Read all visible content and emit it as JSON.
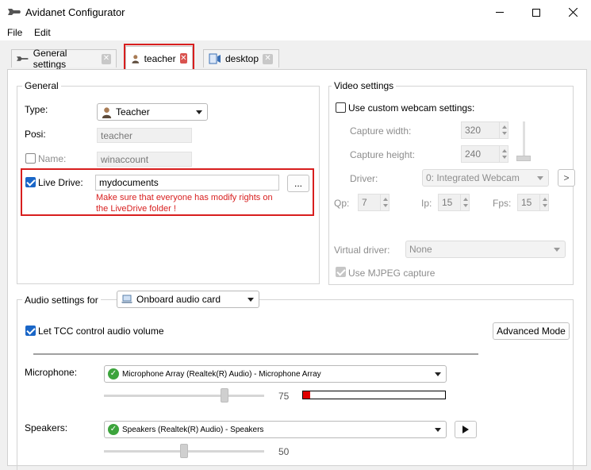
{
  "window": {
    "title": "Avidanet Configurator",
    "minimize_icon": "minimize-icon",
    "maximize_icon": "maximize-icon",
    "close_icon": "close-icon"
  },
  "menu": {
    "items": [
      "File",
      "Edit"
    ]
  },
  "tabs": [
    {
      "label": "General settings",
      "icon": "wrench-icon"
    },
    {
      "label": "teacher",
      "icon": "user-icon"
    },
    {
      "label": "desktop",
      "icon": "desktop-icon"
    }
  ],
  "general": {
    "group_label": "General",
    "type_label": "Type:",
    "type_value": "Teacher",
    "posi_label": "Posi:",
    "posi_value": "teacher",
    "name_label": "Name:",
    "name_value": "winaccount",
    "name_checked": false,
    "live_drive_label": "Live Drive:",
    "live_drive_checked": true,
    "live_drive_value": "mydocuments",
    "browse_label": "...",
    "warning": "Make sure that everyone has modify rights on the LiveDrive folder !"
  },
  "video": {
    "group_label": "Video settings",
    "custom_label": "Use custom webcam settings:",
    "custom_checked": false,
    "capture_width_label": "Capture width:",
    "capture_width_value": "320",
    "capture_height_label": "Capture height:",
    "capture_height_value": "240",
    "driver_label": "Driver:",
    "driver_value": "0: Integrated Webcam",
    "driver_more": ">",
    "qp_label": "Qp:",
    "qp_value": "7",
    "ip_label": "Ip:",
    "ip_value": "15",
    "fps_label": "Fps:",
    "fps_value": "15",
    "virtual_label": "Virtual driver:",
    "virtual_value": "None",
    "mjpeg_label": "Use MJPEG capture",
    "mjpeg_checked": true
  },
  "audio": {
    "group_label": "Audio settings for",
    "card_value": "Onboard audio card",
    "tcc_label": "Let TCC control audio volume",
    "tcc_checked": true,
    "advanced_label": "Advanced Mode",
    "microphone_label": "Microphone:",
    "microphone_value": "Microphone Array (Realtek(R) Audio)  -  Microphone Array",
    "microphone_level": "75",
    "microphone_level_fraction": 0.75,
    "microphone_meter_fraction": 0.05,
    "speakers_label": "Speakers:",
    "speakers_value": "Speakers (Realtek(R) Audio)  -  Speakers",
    "speakers_level": "50",
    "speakers_level_fraction": 0.5,
    "play_icon": "play-icon"
  },
  "colors": {
    "highlight": "#d81e1e",
    "checkbox": "#1a66c7",
    "status_ok": "#3ca43c"
  }
}
